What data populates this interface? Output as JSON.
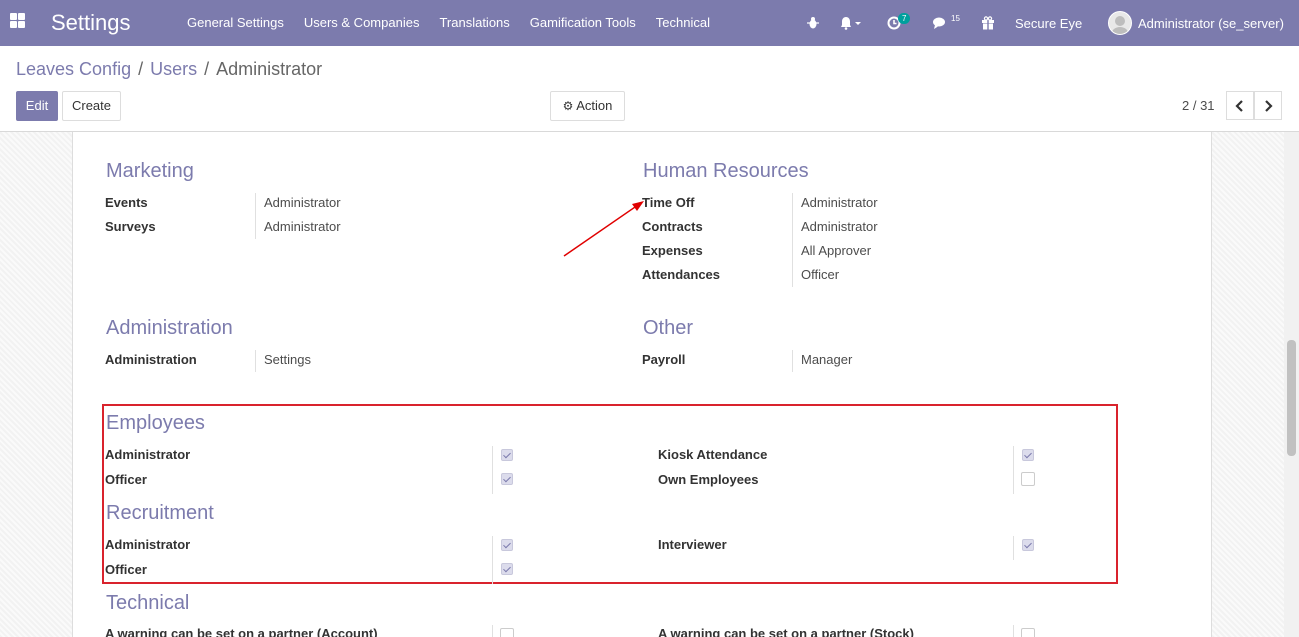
{
  "navbar": {
    "app_title": "Settings",
    "menu": [
      "General Settings",
      "Users & Companies",
      "Translations",
      "Gamification Tools",
      "Technical"
    ],
    "activity_count": "7",
    "message_count": "15",
    "company": "Secure Eye",
    "user": "Administrator (se_server)",
    "icons": [
      "apps-grid-icon",
      "bug-icon",
      "bell-icon",
      "clock-icon",
      "chat-icon",
      "gift-icon"
    ]
  },
  "breadcrumb": [
    "Leaves Config",
    "Users",
    "Administrator"
  ],
  "buttons": {
    "edit": "Edit",
    "create": "Create",
    "action": "Action"
  },
  "pager": {
    "text": "2 / 31"
  },
  "sections": {
    "marketing": {
      "title": "Marketing",
      "rows": [
        {
          "label": "Events",
          "value": "Administrator"
        },
        {
          "label": "Surveys",
          "value": "Administrator"
        }
      ]
    },
    "hr": {
      "title": "Human Resources",
      "rows": [
        {
          "label": "Time Off",
          "value": "Administrator"
        },
        {
          "label": "Contracts",
          "value": "Administrator"
        },
        {
          "label": "Expenses",
          "value": "All Approver"
        },
        {
          "label": "Attendances",
          "value": "Officer"
        }
      ]
    },
    "administration": {
      "title": "Administration",
      "rows": [
        {
          "label": "Administration",
          "value": "Settings"
        }
      ]
    },
    "other": {
      "title": "Other",
      "rows": [
        {
          "label": "Payroll",
          "value": "Manager"
        }
      ]
    },
    "employees": {
      "title": "Employees",
      "left": [
        {
          "label": "Administrator",
          "checked": true
        },
        {
          "label": "Officer",
          "checked": true
        }
      ],
      "right": [
        {
          "label": "Kiosk Attendance",
          "checked": true
        },
        {
          "label": "Own Employees",
          "checked": false
        }
      ]
    },
    "recruitment": {
      "title": "Recruitment",
      "left": [
        {
          "label": "Administrator",
          "checked": true
        },
        {
          "label": "Officer",
          "checked": true
        }
      ],
      "right": [
        {
          "label": "Interviewer",
          "checked": true
        }
      ]
    },
    "technical": {
      "title": "Technical",
      "left": [
        {
          "label": "A warning can be set on a partner (Account)",
          "checked": false
        }
      ],
      "right": [
        {
          "label": "A warning can be set on a partner (Stock)",
          "checked": false
        }
      ]
    }
  },
  "colors": {
    "brand": "#7c7bad",
    "highlight_box": "#d9232d",
    "arrow": "#e00000"
  }
}
